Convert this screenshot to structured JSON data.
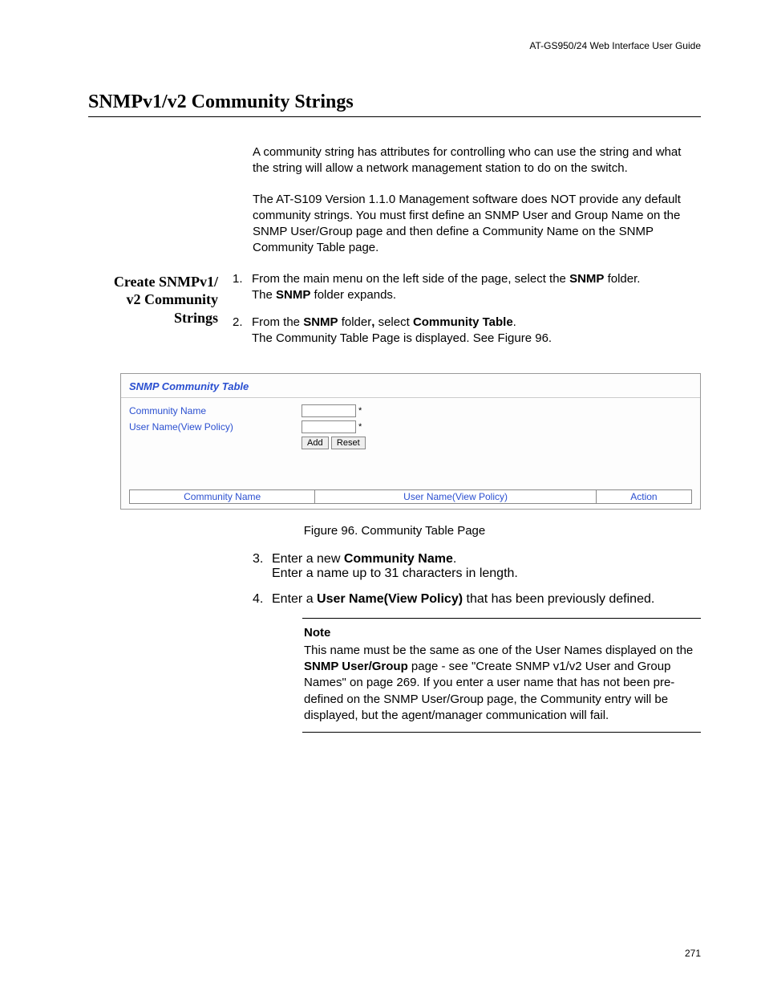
{
  "header": {
    "guide": "AT-GS950/24  Web Interface User Guide"
  },
  "title": "SNMPv1/v2 Community Strings",
  "intro": {
    "p1": "A community string has attributes for controlling who can use the string and what the string will allow a network management station to do on the switch.",
    "p2": "The AT-S109 Version 1.1.0  Management software does NOT provide any default community strings. You must first define an SNMP User and Group Name on the SNMP User/Group page and then define a Community Name on the SNMP Community Table page."
  },
  "side_heading": {
    "l1": "Create SNMPv1/",
    "l2": "v2 Community",
    "l3": "Strings"
  },
  "steps": {
    "s1_num": "1.",
    "s1_a": "From the main menu on the left side of the page, select the ",
    "s1_bold": "SNMP",
    "s1_b": " folder.",
    "s1_c1": "The ",
    "s1_c_bold": "SNMP",
    "s1_c2": " folder expands.",
    "s2_num": "2.",
    "s2_a": "From the ",
    "s2_b1": "SNMP",
    "s2_b": " folder",
    "s2_comma": ",",
    "s2_c": " select ",
    "s2_b2": "Community Table",
    "s2_d": ".",
    "s2_e": "The Community Table Page is displayed. See Figure 96.",
    "s3_num": "3.",
    "s3_a": "Enter a new ",
    "s3_bold": "Community Name",
    "s3_b": ".",
    "s3_c": "Enter a name up to 31 characters in length.",
    "s4_num": "4.",
    "s4_a": "Enter a ",
    "s4_bold": "User Name(View Policy)",
    "s4_b": " that has been previously defined."
  },
  "screenshot": {
    "title": "SNMP Community Table",
    "label1": "Community Name",
    "label2": "User Name(View Policy)",
    "add": "Add",
    "reset": "Reset",
    "col1": "Community Name",
    "col2": "User Name(View Policy)",
    "col3": "Action"
  },
  "figure_caption": "Figure 96. Community Table Page",
  "note": {
    "label": "Note",
    "t1": "This name must be the same as one of the User Names displayed on the ",
    "bold": "SNMP User/Group",
    "t2": " page - see \"Create SNMP v1/v2 User and Group Names\" on page 269. If you enter a user name that has not been pre-defined on the SNMP User/Group page, the Community entry will be displayed, but the agent/manager communication will fail."
  },
  "page_number": "271"
}
